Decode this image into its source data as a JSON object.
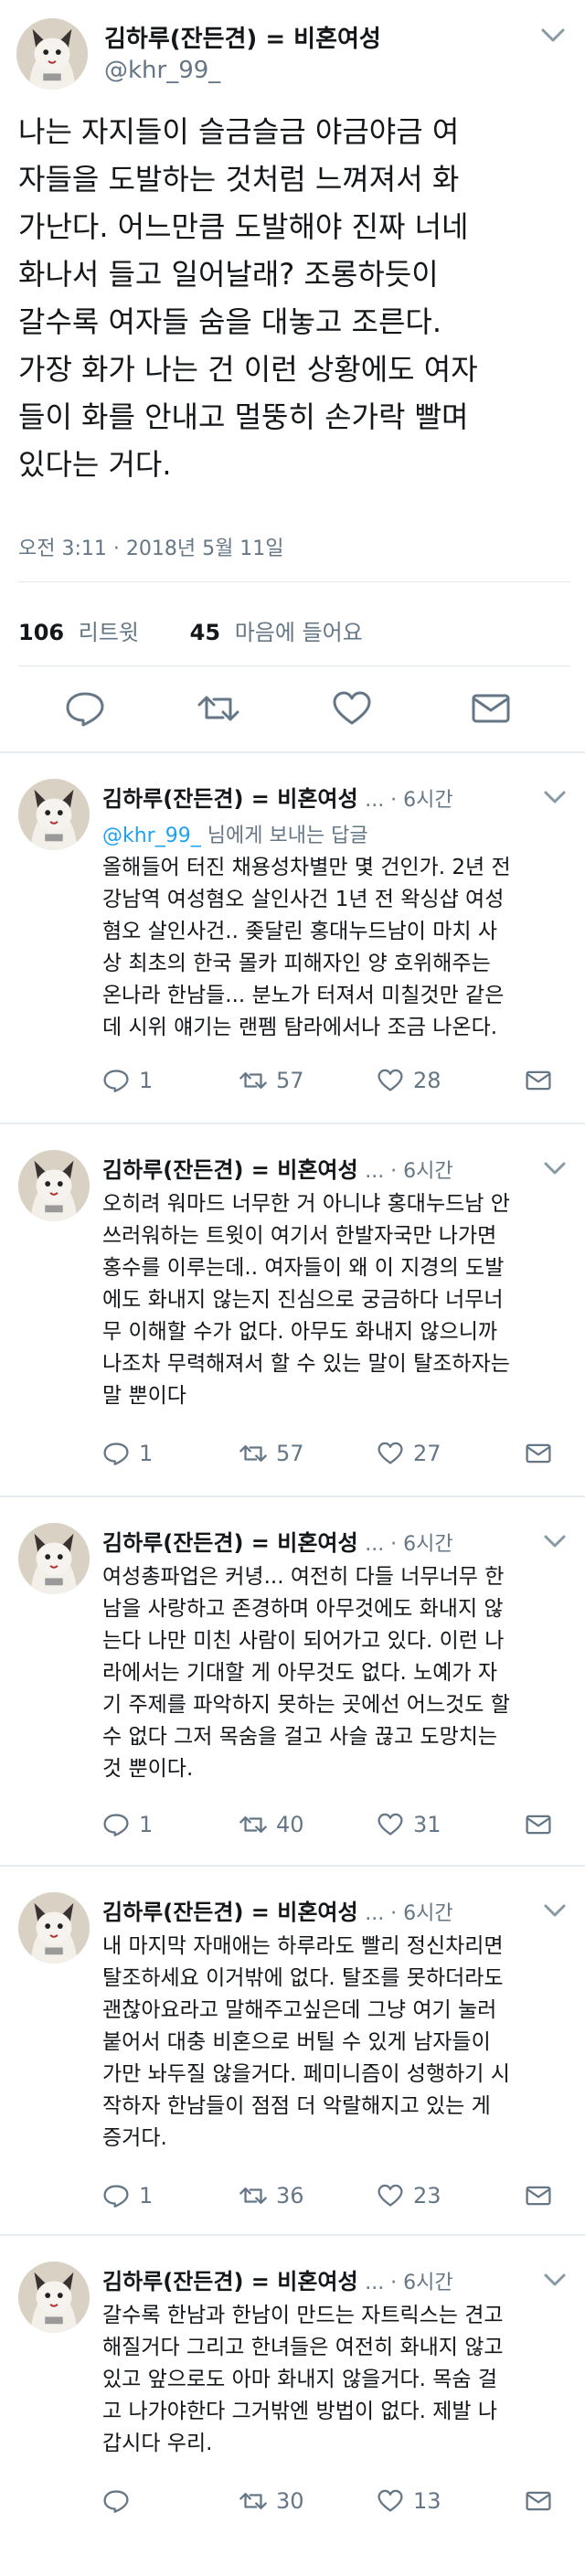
{
  "colors": {
    "accent": "#1da1f2",
    "muted": "#657786",
    "text": "#14171a",
    "border": "#e1e8ed"
  },
  "tweet": {
    "author_name": "김하루(잔든견) = 비혼여성",
    "author_handle": "@khr_99_",
    "text_lines": [
      "나는 자지들이 슬금슬금 야금야금 여",
      "자들을 도발하는 것처럼 느껴져서 화",
      "가난다. 어느만큼 도발해야 진짜 너네",
      "화나서 들고 일어날래? 조롱하듯이",
      "갈수록 여자들 숨을 대놓고 조른다.",
      "가장 화가 나는 건 이런 상황에도 여자",
      "들이 화를 안내고 멀뚱히 손가락 빨며",
      "있다는 거다."
    ],
    "timestamp": "오전 3:11 · 2018년 5월 11일",
    "retweets_count": "106",
    "retweets_label": "리트윗",
    "likes_count": "45",
    "likes_label": "마음에 들어요",
    "actions": [
      "reply-icon",
      "retweet-icon",
      "like-icon",
      "message-icon"
    ]
  },
  "replies": [
    {
      "name": "김하루(잔든견) = 비혼여성",
      "meta": "... · 6시간",
      "reply_to_handle": "@khr_99_",
      "reply_to_suffix": "님에게 보내는 답글",
      "text_lines": [
        "올해들어 터진 채용성차별만 몇 건인가. 2년 전",
        "강남역 여성혐오 살인사건 1년 전 왁싱샵 여성",
        "혐오 살인사건.. 좆달린 홍대누드남이 마치 사",
        "상 최초의 한국 몰카 피해자인 양 호위해주는",
        "온나라 한남들... 분노가 터져서 미칠것만 같은",
        "데 시위 얘기는 랜펨 탐라에서나 조금 나온다."
      ],
      "replies_count": "1",
      "retweets_count": "57",
      "likes_count": "28"
    },
    {
      "name": "김하루(잔든견) = 비혼여성",
      "meta": "... · 6시간",
      "text_lines": [
        "오히려 워마드 너무한 거 아니냐 홍대누드남 안",
        "쓰러워하는 트윗이 여기서 한발자국만 나가면",
        "홍수를 이루는데.. 여자들이 왜 이 지경의 도발",
        "에도 화내지 않는지 진심으로 궁금하다 너무너",
        "무 이해할 수가 없다. 아무도 화내지 않으니까",
        "나조차 무력해져서 할 수 있는 말이 탈조하자는",
        "말 뿐이다"
      ],
      "replies_count": "1",
      "retweets_count": "57",
      "likes_count": "27"
    },
    {
      "name": "김하루(잔든견) = 비혼여성",
      "meta": "... · 6시간",
      "text_lines": [
        "여성총파업은 커녕... 여전히 다들 너무너무 한",
        "남을 사랑하고 존경하며 아무것에도 화내지 않",
        "는다 나만 미친 사람이 되어가고 있다. 이런 나",
        "라에서는 기대할 게 아무것도 없다. 노예가 자",
        "기 주제를 파악하지 못하는 곳에선 어느것도 할",
        "수 없다 그저 목숨을 걸고 사슬 끊고 도망치는",
        "것 뿐이다."
      ],
      "replies_count": "1",
      "retweets_count": "40",
      "likes_count": "31"
    },
    {
      "name": "김하루(잔든견) = 비혼여성",
      "meta": "... · 6시간",
      "text_lines": [
        "내 마지막 자매애는 하루라도 빨리 정신차리면",
        "탈조하세요 이거밖에 없다. 탈조를 못하더라도",
        "괜찮아요라고 말해주고싶은데 그냥 여기 눌러",
        "붙어서 대충 비혼으로 버틸 수 있게 남자들이",
        "가만 놔두질 않을거다. 페미니즘이 성행하기 시",
        "작하자 한남들이 점점 더 악랄해지고 있는 게",
        "증거다."
      ],
      "replies_count": "1",
      "retweets_count": "36",
      "likes_count": "23"
    },
    {
      "name": "김하루(잔든견) = 비혼여성",
      "meta": "... · 6시간",
      "text_lines": [
        "갈수록 한남과 한남이 만드는 자트릭스는 견고",
        "해질거다 그리고 한녀들은 여전히 화내지 않고",
        "있고 앞으로도 아마 화내지 않을거다. 목숨 걸",
        "고 나가야한다 그거밖엔 방법이 없다. 제발 나",
        "갑시다 우리."
      ],
      "replies_count": "",
      "retweets_count": "30",
      "likes_count": "13"
    }
  ]
}
